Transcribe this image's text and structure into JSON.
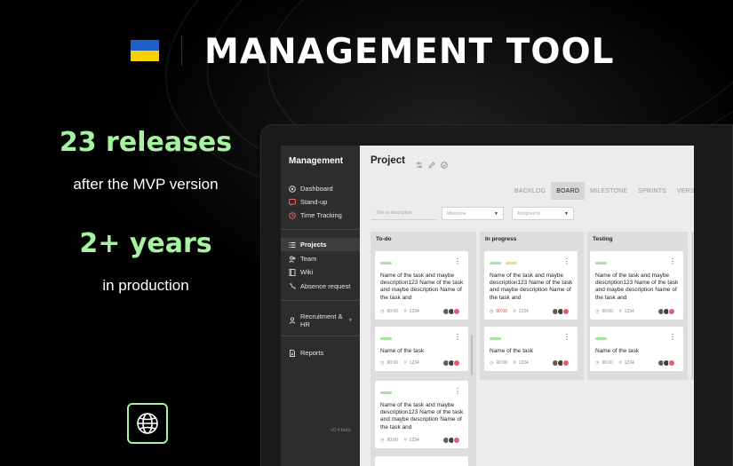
{
  "header": {
    "title": "MANAGEMENT TOOL",
    "flag_colors": [
      "#1f5fc9",
      "#f6d200"
    ]
  },
  "stats": [
    {
      "value": "23 releases",
      "caption": "after the MVP version"
    },
    {
      "value": "2+ years",
      "caption": "in production"
    }
  ],
  "footer_icon": "globe-icon",
  "colors": {
    "accent": "#a6f3a0",
    "background": "#000000"
  },
  "app": {
    "sidebar": {
      "title": "Management",
      "items": [
        {
          "label": "Dashboard",
          "icon": "dashboard-icon"
        },
        {
          "label": "Stand-up",
          "icon": "chat-icon"
        },
        {
          "label": "Time Tracking",
          "icon": "clock-icon"
        },
        {
          "label": "Projects",
          "icon": "list-icon",
          "active": true
        },
        {
          "label": "Team",
          "icon": "team-icon"
        },
        {
          "label": "Wiki",
          "icon": "book-icon"
        },
        {
          "label": "Absence request",
          "icon": "absence-icon"
        },
        {
          "label": "Recruitment & HR",
          "icon": "recruit-icon"
        },
        {
          "label": "Reports",
          "icon": "report-icon"
        }
      ],
      "version": "v0.4 beta"
    },
    "project_title": "Project",
    "tabs": [
      "BACKLOG",
      "BOARD",
      "MILESTONE",
      "SPRINTS",
      "VERSI"
    ],
    "active_tab": "BOARD",
    "filters": {
      "search_placeholder": "Title or description",
      "milestone_placeholder": "Milestone",
      "assigned_placeholder": "Assigned to"
    },
    "columns": [
      {
        "title": "To-do",
        "cards": [
          {
            "text": "Name of the task and maybe description123 Name of the task and maybe description Name of the task and",
            "time": "90:00",
            "id": "1234",
            "labels": [
              "#a6e3a0"
            ]
          },
          {
            "text": "Name of the task",
            "time": "90:00",
            "id": "1234",
            "labels": [
              "#a6e3a0"
            ]
          },
          {
            "text": "Name of the task and maybe description123 Name of the task and maybe description Name of the task and",
            "time": "90:00",
            "id": "1234",
            "labels": [
              "#a6e3a0"
            ]
          }
        ]
      },
      {
        "title": "In progress",
        "cards": [
          {
            "text": "Name of the task and maybe description123 Name of the task and maybe description Name of the task and",
            "time": "90:00",
            "time_overdue": true,
            "id": "1234",
            "labels": [
              "#a6e3a0",
              "#f1dc7a"
            ]
          },
          {
            "text": "Name of the task",
            "time": "90:00",
            "id": "1234",
            "labels": [
              "#a6e3a0"
            ]
          }
        ]
      },
      {
        "title": "Testing",
        "cards": [
          {
            "text": "Name of the task and maybe description123 Name of the task and maybe description Name of the task and",
            "time": "90:00",
            "id": "1234",
            "labels": [
              "#a6e3a0"
            ]
          },
          {
            "text": "Name of the task",
            "time": "90:00",
            "id": "1234",
            "labels": [
              "#a6e3a0"
            ]
          }
        ]
      }
    ]
  }
}
